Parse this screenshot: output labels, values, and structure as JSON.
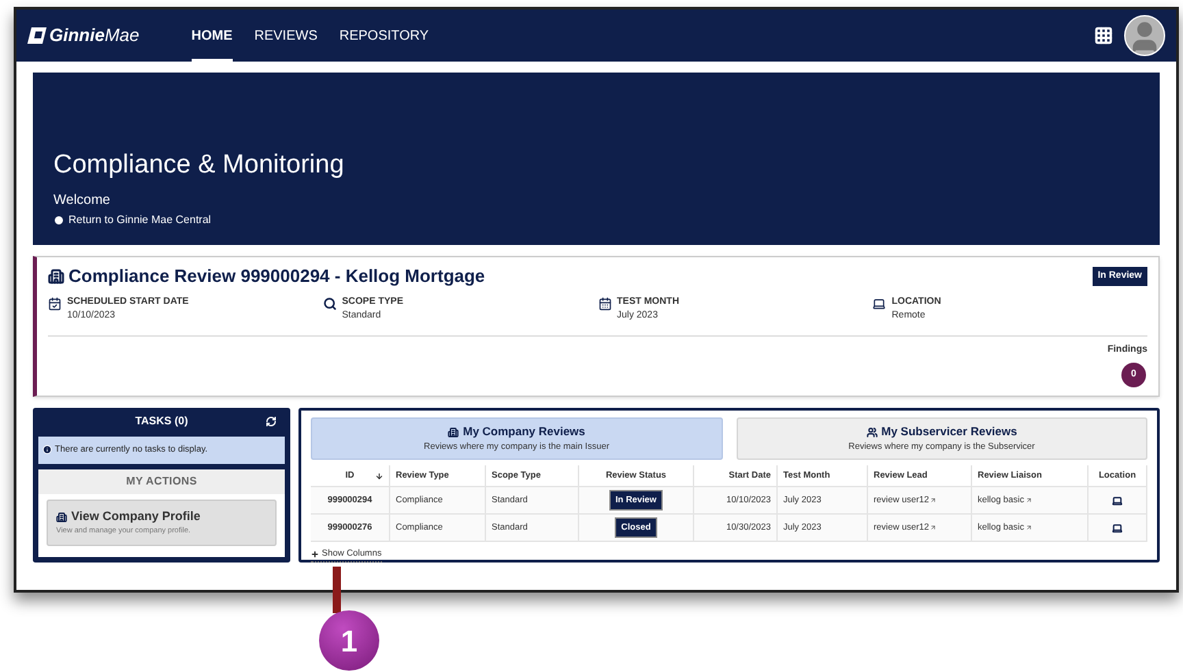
{
  "nav": {
    "logo": "**Ginnie**Mae",
    "tabs": [
      {
        "label": "HOME",
        "selected": true
      },
      {
        "label": "REVIEWS",
        "selected": false
      },
      {
        "label": "REPOSITORY",
        "selected": false
      }
    ]
  },
  "hero": {
    "title": "Compliance & Monitoring",
    "subtitle": "Welcome",
    "link": "Return to Ginnie Mae Central"
  },
  "review": {
    "title": "Compliance Review 999000294 - Kellog Mortgage",
    "status": "In Review",
    "fields": [
      {
        "kind": "date",
        "label": "SCHEDULED START DATE",
        "value": "10/10/2023"
      },
      {
        "kind": "scope",
        "label": "SCOPE TYPE",
        "value": "Standard"
      },
      {
        "kind": "month",
        "label": "TEST MONTH",
        "value": "July 2023"
      },
      {
        "kind": "location",
        "label": "LOCATION",
        "value": "Remote"
      }
    ],
    "findings_label": "Findings",
    "findings_count": "0"
  },
  "tasks": {
    "title": "TASKS (0)",
    "empty_message": "There are currently no tasks to display.",
    "actions_title": "MY ACTIONS",
    "actions": [
      {
        "title": "View Company Profile",
        "description": "View and manage your company profile."
      }
    ]
  },
  "reviews": {
    "tabs": [
      {
        "kind": "company",
        "title": "My Company Reviews",
        "subtitle": "Reviews where my company is the main Issuer",
        "selected": true
      },
      {
        "kind": "subservicer",
        "title": "My Subservicer Reviews",
        "subtitle": "Reviews where my company is the Subservicer",
        "selected": false
      }
    ],
    "table": {
      "columns": [
        "ID",
        "Review Type",
        "Scope Type",
        "Review Status",
        "Start Date",
        "Test Month",
        "Review Lead",
        "Review Liaison",
        "Location"
      ],
      "rows": [
        {
          "id": "999000294",
          "review_type": "Compliance",
          "scope_type": "Standard",
          "status": "In Review",
          "start_date": "10/10/2023",
          "test_month": "July 2023",
          "lead": "review user12",
          "liaison": "kellog basic"
        },
        {
          "id": "999000276",
          "review_type": "Compliance",
          "scope_type": "Standard",
          "status": "Closed",
          "start_date": "10/30/2023",
          "test_month": "July 2023",
          "lead": "review user12",
          "liaison": "kellog basic"
        }
      ]
    },
    "show_columns": "Show Columns"
  },
  "callout": "1"
}
